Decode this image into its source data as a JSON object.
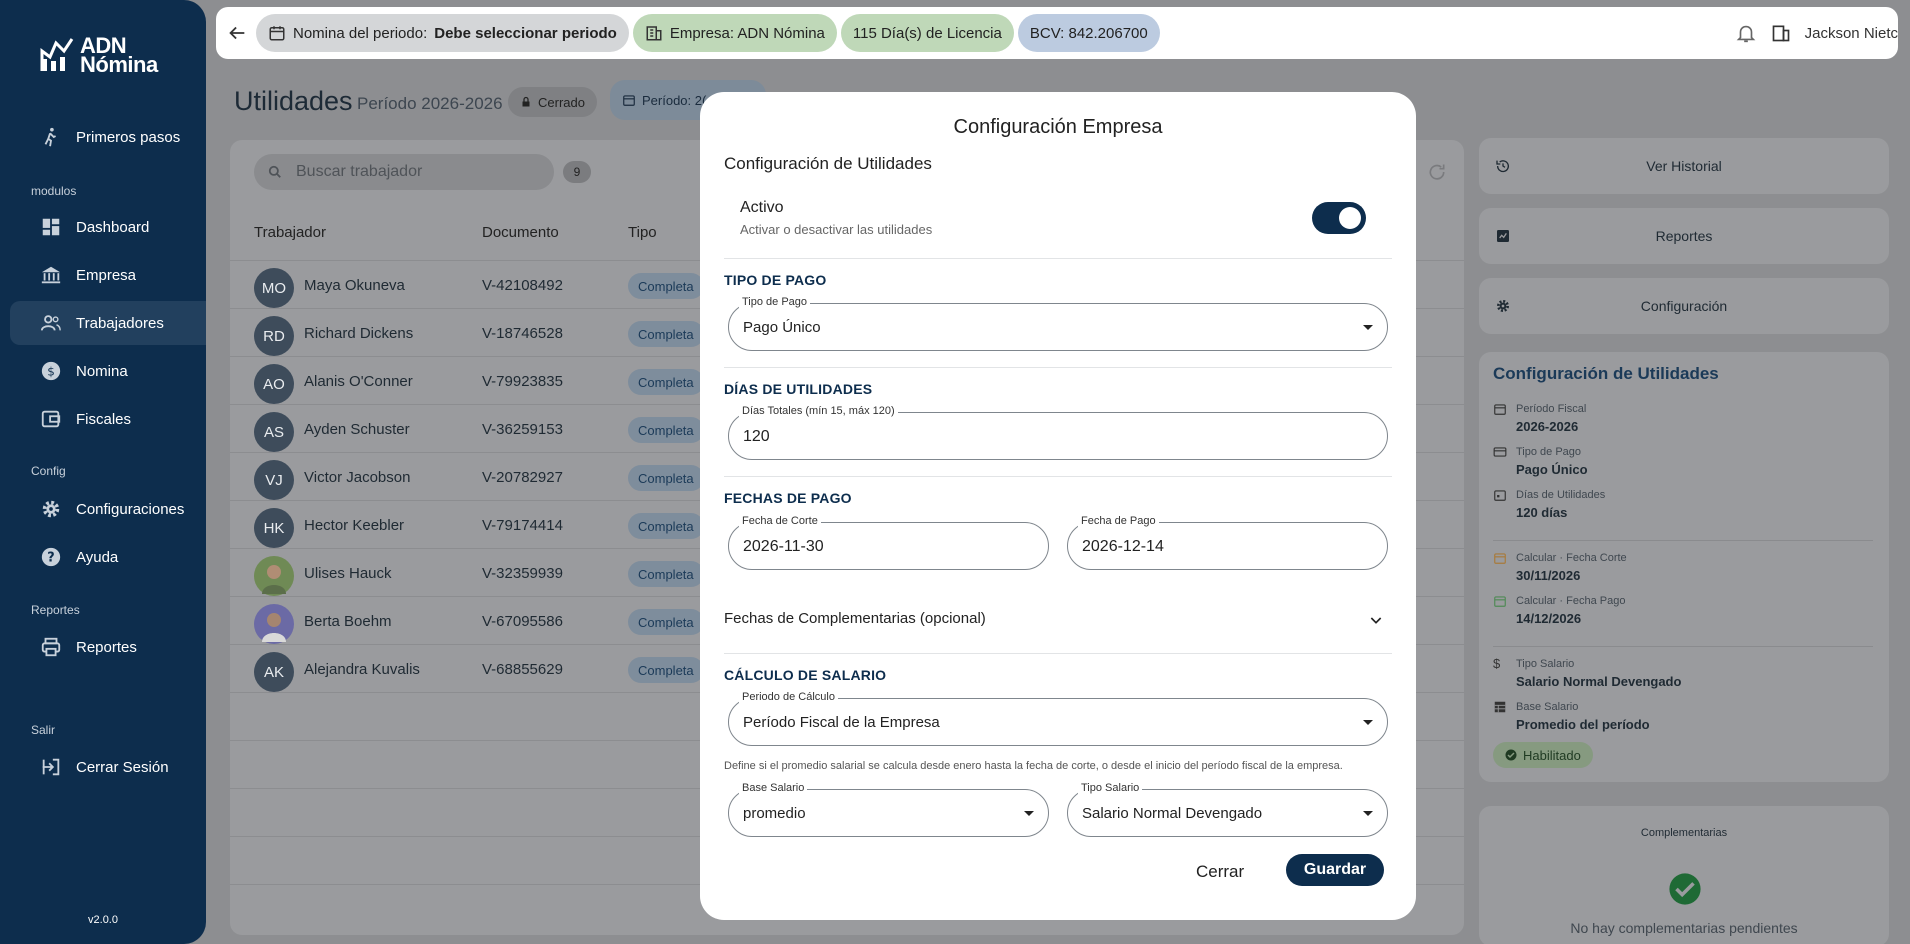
{
  "app": {
    "brand_line1": "ADN",
    "brand_line2": "Nómina",
    "version": "v2.0.0"
  },
  "sidebar": {
    "items": [
      {
        "label": "Primeros pasos",
        "icon": "walking-person-icon"
      },
      {
        "label": "Dashboard",
        "icon": "dashboard-icon"
      },
      {
        "label": "Empresa",
        "icon": "bank-icon"
      },
      {
        "label": "Trabajadores",
        "icon": "people-icon"
      },
      {
        "label": "Nomina",
        "icon": "money-icon"
      },
      {
        "label": "Fiscales",
        "icon": "wallet-icon"
      },
      {
        "label": "Configuraciones",
        "icon": "gear-icon"
      },
      {
        "label": "Ayuda",
        "icon": "help-icon"
      },
      {
        "label": "Reportes",
        "icon": "printer-icon"
      },
      {
        "label": "Cerrar Sesión",
        "icon": "logout-icon"
      }
    ],
    "sections": {
      "modulos": "modulos",
      "config": "Config",
      "reportes": "Reportes",
      "salir": "Salir"
    }
  },
  "topbar": {
    "periodo_label": "Nomina del periodo:",
    "periodo_value": "Debe seleccionar periodo",
    "empresa": "Empresa: ADN Nómina",
    "licencia": "115 Día(s) de Licencia",
    "bcv": "BCV: 842.206700",
    "user": "Jackson Nietc"
  },
  "page": {
    "title": "Utilidades",
    "subtitle": "Período 2026-2026",
    "status": "Cerrado",
    "periodo_tag": "Período: 2("
  },
  "table": {
    "search_placeholder": "Buscar trabajador",
    "count": "9",
    "headers": {
      "trabajador": "Trabajador",
      "documento": "Documento",
      "tipo": "Tipo"
    },
    "rows": [
      {
        "initials": "MO",
        "name": "Maya Okuneva",
        "doc": "V-42108492",
        "tipo": "Completa"
      },
      {
        "initials": "RD",
        "name": "Richard Dickens",
        "doc": "V-18746528",
        "tipo": "Completa"
      },
      {
        "initials": "AO",
        "name": "Alanis O'Conner",
        "doc": "V-79923835",
        "tipo": "Completa"
      },
      {
        "initials": "AS",
        "name": "Ayden Schuster",
        "doc": "V-36259153",
        "tipo": "Completa"
      },
      {
        "initials": "VJ",
        "name": "Victor Jacobson",
        "doc": "V-20782927",
        "tipo": "Completa"
      },
      {
        "initials": "HK",
        "name": "Hector Keebler",
        "doc": "V-79174414",
        "tipo": "Completa"
      },
      {
        "initials": "",
        "name": "Ulises Hauck",
        "doc": "V-32359939",
        "tipo": "Completa"
      },
      {
        "initials": "",
        "name": "Berta Boehm",
        "doc": "V-67095586",
        "tipo": "Completa"
      },
      {
        "initials": "AK",
        "name": "Alejandra Kuvalis",
        "doc": "V-68855629",
        "tipo": "Completa"
      }
    ]
  },
  "right_panel": {
    "historial": "Ver Historial",
    "reportes": "Reportes",
    "configuracion": "Configuración",
    "config_title": "Configuración de Utilidades",
    "info": [
      {
        "label": "Período Fiscal",
        "value": "2026-2026"
      },
      {
        "label": "Tipo de Pago",
        "value": "Pago Único"
      },
      {
        "label": "Días de Utilidades",
        "value": "120 días"
      },
      {
        "label": "Calcular · Fecha Corte",
        "value": "30/11/2026"
      },
      {
        "label": "Calcular · Fecha Pago",
        "value": "14/12/2026"
      },
      {
        "label": "Tipo Salario",
        "value": "Salario Normal Devengado"
      },
      {
        "label": "Base Salario",
        "value": "Promedio del período"
      }
    ],
    "habilitado": "Habilitado",
    "complementarias_title": "Complementarias",
    "complementarias_empty": "No hay complementarias pendientes"
  },
  "modal": {
    "title": "Configuración Empresa",
    "section_title": "Configuración de Utilidades",
    "activo_label": "Activo",
    "activo_desc": "Activar o desactivar las utilidades",
    "activo_on": true,
    "tipo_pago_head": "TIPO DE PAGO",
    "tipo_pago_label": "Tipo de Pago",
    "tipo_pago_value": "Pago Único",
    "dias_head": "DÍAS DE UTILIDADES",
    "dias_label": "Días Totales (mín 15, máx 120)",
    "dias_value": "120",
    "fechas_head": "FECHAS DE PAGO",
    "corte_label": "Fecha de Corte",
    "corte_value": "2026-11-30",
    "pago_label": "Fecha de Pago",
    "pago_value": "2026-12-14",
    "complementarias": "Fechas de Complementarias (opcional)",
    "calculo_head": "CÁLCULO DE SALARIO",
    "periodo_calc_label": "Periodo de Cálculo",
    "periodo_calc_value": "Período Fiscal de la Empresa",
    "help_text": "Define si el promedio salarial se calcula desde enero hasta la fecha de corte, o desde el inicio del período fiscal de la empresa.",
    "base_label": "Base Salario",
    "base_value": "promedio",
    "tipo_salario_label": "Tipo Salario",
    "tipo_salario_value": "Salario Normal Devengado",
    "close": "Cerrar",
    "save": "Guardar"
  },
  "colors": {
    "primary": "#0d2d4d",
    "success": "#2e9e4f"
  }
}
